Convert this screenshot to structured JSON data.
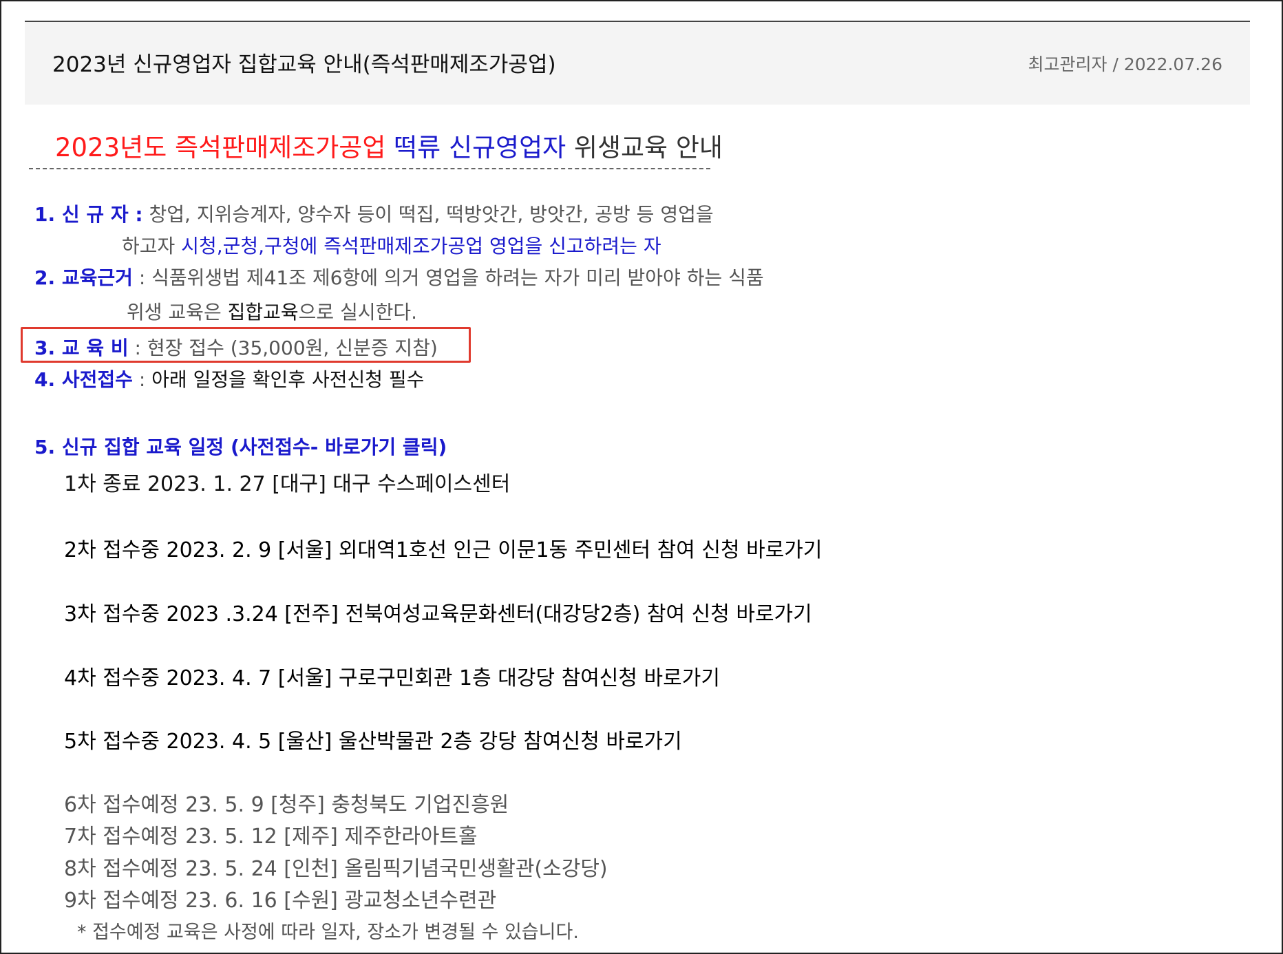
{
  "post": {
    "title": "2023년 신규영업자 집합교육 안내(즉석판매제조가공업)",
    "meta": "최고관리자 / 2022.07.26"
  },
  "doc_title": {
    "part_red": "2023년도 즉석판매제조가공업 ",
    "part_blue": "떡류 신규영업자",
    "part_dark": " 위생교육 안내"
  },
  "items": {
    "i1": {
      "label": "1. 신 규 자 :",
      "text1": " 창업, 지위승계자, 양수자 등이 떡집, 떡방앗간, 방앗간, 공방 등 영업을",
      "text2_plain": "하고자 ",
      "text2_blue": "시청,군청,구청에  즉석판매제조가공업 영업을 신고하려는 자"
    },
    "i2": {
      "label": "2. 교육근거",
      "text1": " : 식품위생법 제41조 제6항에 의거 영업을 하려는 자가  미리 받아야 하는 식품",
      "text2_a": "위생 교육은 ",
      "text2_b": "집합교육",
      "text2_c": "으로 실시한다."
    },
    "i3": {
      "label": "3. 교 육 비",
      "text": "  : 현장 접수 (35,000원, 신분증 지참)"
    },
    "i4": {
      "label": "4. 사전접수",
      "colon": " : ",
      "text": "아래 일정을 확인후 사전신청 필수"
    },
    "i5": {
      "label": "5. 신규 집합 교육 일정 (사전접수- 바로가기 클릭)"
    }
  },
  "schedule": {
    "s1": "1차 종료 2023. 1. 27 [대구] 대구 수스페이스센터",
    "s2": "2차 접수중 2023. 2. 9 [서울] 외대역1호선 인근 이문1동 주민센터  참여 신청 바로가기",
    "s3": "3차 접수중 2023 .3.24 [전주] 전북여성교육문화센터(대강당2층) 참여 신청 바로가기",
    "s4": "4차 접수중 2023. 4. 7 [서울] 구로구민회관 1층 대강당 참여신청 바로가기",
    "s5": "5차 접수중 2023. 4. 5 [울산] 울산박물관 2층 강당 참여신청 바로가기",
    "s6": "6차 접수예정 23. 5. 9 [청주] 충청북도 기업진흥원",
    "s7": "7차 접수예정 23. 5. 12 [제주] 제주한라아트홀",
    "s8": "8차 접수예정 23. 5. 24 [인천] 올림픽기념국민생활관(소강당)",
    "s9": "9차 접수예정 23. 6. 16 [수원] 광교청소년수련관",
    "note": "* 접수예정 교육은 사정에 따라 일자, 장소가 변경될 수 있습니다."
  },
  "colors": {
    "accent_red": "#ff1a1a",
    "accent_blue": "#1a1acc",
    "highlight_box": "#e03a2e"
  }
}
